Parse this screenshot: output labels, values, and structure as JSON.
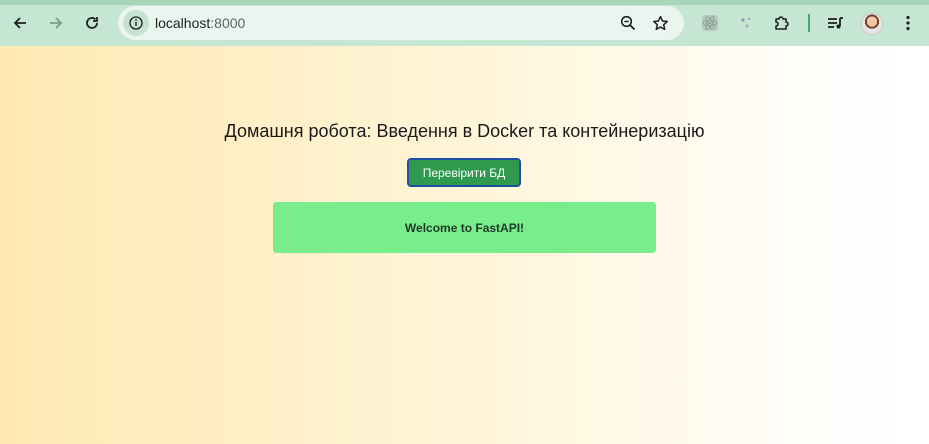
{
  "browser": {
    "url_host": "localhost",
    "url_port": ":8000",
    "icons": {
      "back": "arrow-left-icon",
      "forward": "arrow-right-icon",
      "reload": "reload-icon",
      "site_info": "info-icon",
      "zoom": "zoom-out-icon",
      "bookmark": "star-icon",
      "ext1": "react-devtools-icon",
      "ext2": "sparkle-extension-icon",
      "extensions": "puzzle-icon",
      "media": "media-queue-icon",
      "menu": "kebab-menu-icon"
    }
  },
  "page": {
    "heading": "Домашня робота: Введення в Docker та контейнеризацію",
    "check_button": "Перевірити БД",
    "message": "Welcome to FastAPI!"
  },
  "colors": {
    "toolbar": "#c4e6d2",
    "button": "#2f9a4e",
    "message_bg": "#79ec8c",
    "gradient_left": "#ffe9b2"
  }
}
